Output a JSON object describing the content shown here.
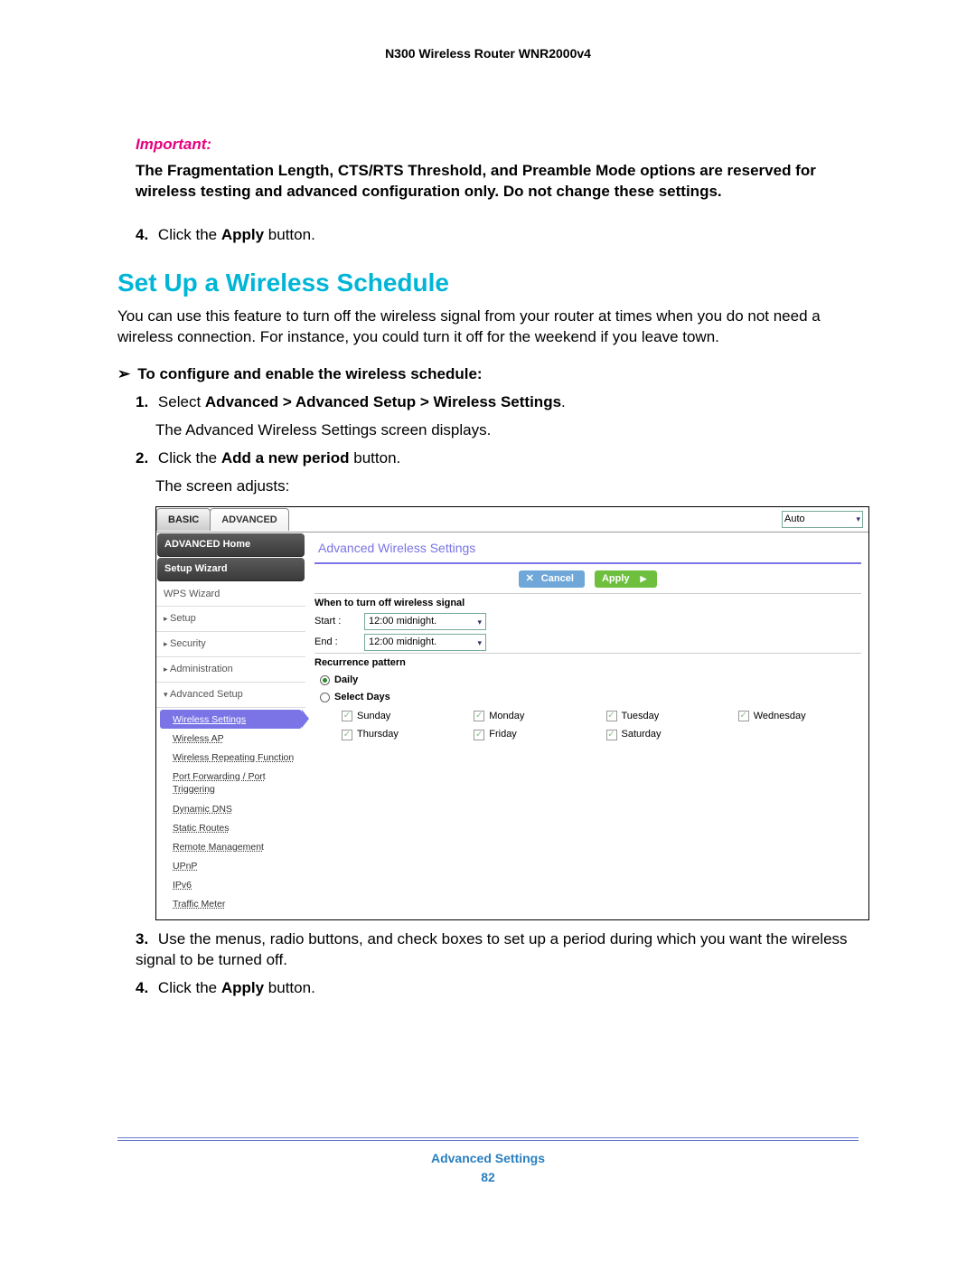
{
  "header": {
    "title": "N300 Wireless Router WNR2000v4"
  },
  "important": {
    "label": "Important:",
    "text": "The Fragmentation Length, CTS/RTS Threshold, and Preamble Mode options are reserved for wireless testing and advanced configuration only. Do not change these settings."
  },
  "preStep4": {
    "num": "4.",
    "pre": "Click the ",
    "bold": "Apply",
    "post": " button."
  },
  "section": {
    "title": "Set Up a Wireless Schedule",
    "intro": "You can use this feature to turn off the wireless signal from your router at times when you do not need a wireless connection. For instance, you could turn it off for the weekend if you leave town."
  },
  "procedure": {
    "lead": "To configure and enable the wireless schedule:",
    "step1": {
      "num": "1.",
      "pre": "Select ",
      "bold": "Advanced > Advanced Setup > Wireless Settings",
      "post": "."
    },
    "step1_sub": "The Advanced Wireless Settings screen displays.",
    "step2": {
      "num": "2.",
      "pre": "Click the ",
      "bold": "Add a new period",
      "post": " button."
    },
    "step2_sub": "The screen adjusts:",
    "step3": {
      "num": "3.",
      "text": "Use the menus, radio buttons, and check boxes to set up a period during which you want the wireless signal to be turned off."
    },
    "step4": {
      "num": "4.",
      "pre": "Click the ",
      "bold": "Apply",
      "post": " button."
    }
  },
  "ui": {
    "tabs": {
      "basic": "BASIC",
      "advanced": "ADVANCED"
    },
    "topSelect": "Auto",
    "sidebar": {
      "advancedHome": "ADVANCED Home",
      "setupWizard": "Setup Wizard",
      "wpsWizard": "WPS Wizard",
      "setup": "Setup",
      "security": "Security",
      "administration": "Administration",
      "advancedSetup": "Advanced Setup",
      "sub": {
        "wirelessSettings": "Wireless Settings",
        "wirelessAP": "Wireless AP",
        "wirelessRepeating": "Wireless Repeating Function",
        "portForwarding": "Port Forwarding / Port Triggering",
        "dynamicDNS": "Dynamic DNS",
        "staticRoutes": "Static Routes",
        "remoteManagement": "Remote Management",
        "upnp": "UPnP",
        "ipv6": "IPv6",
        "trafficMeter": "Traffic Meter"
      }
    },
    "panel": {
      "title": "Advanced Wireless Settings",
      "cancel": "Cancel",
      "apply": "Apply",
      "whenOff": "When to turn off wireless signal",
      "startLabel": "Start :",
      "startValue": "12:00 midnight.",
      "endLabel": "End :",
      "endValue": "12:00 midnight.",
      "recurrence": "Recurrence pattern",
      "daily": "Daily",
      "selectDays": "Select Days",
      "days": {
        "sun": "Sunday",
        "mon": "Monday",
        "tue": "Tuesday",
        "wed": "Wednesday",
        "thu": "Thursday",
        "fri": "Friday",
        "sat": "Saturday"
      }
    }
  },
  "footer": {
    "title": "Advanced Settings",
    "page": "82"
  }
}
